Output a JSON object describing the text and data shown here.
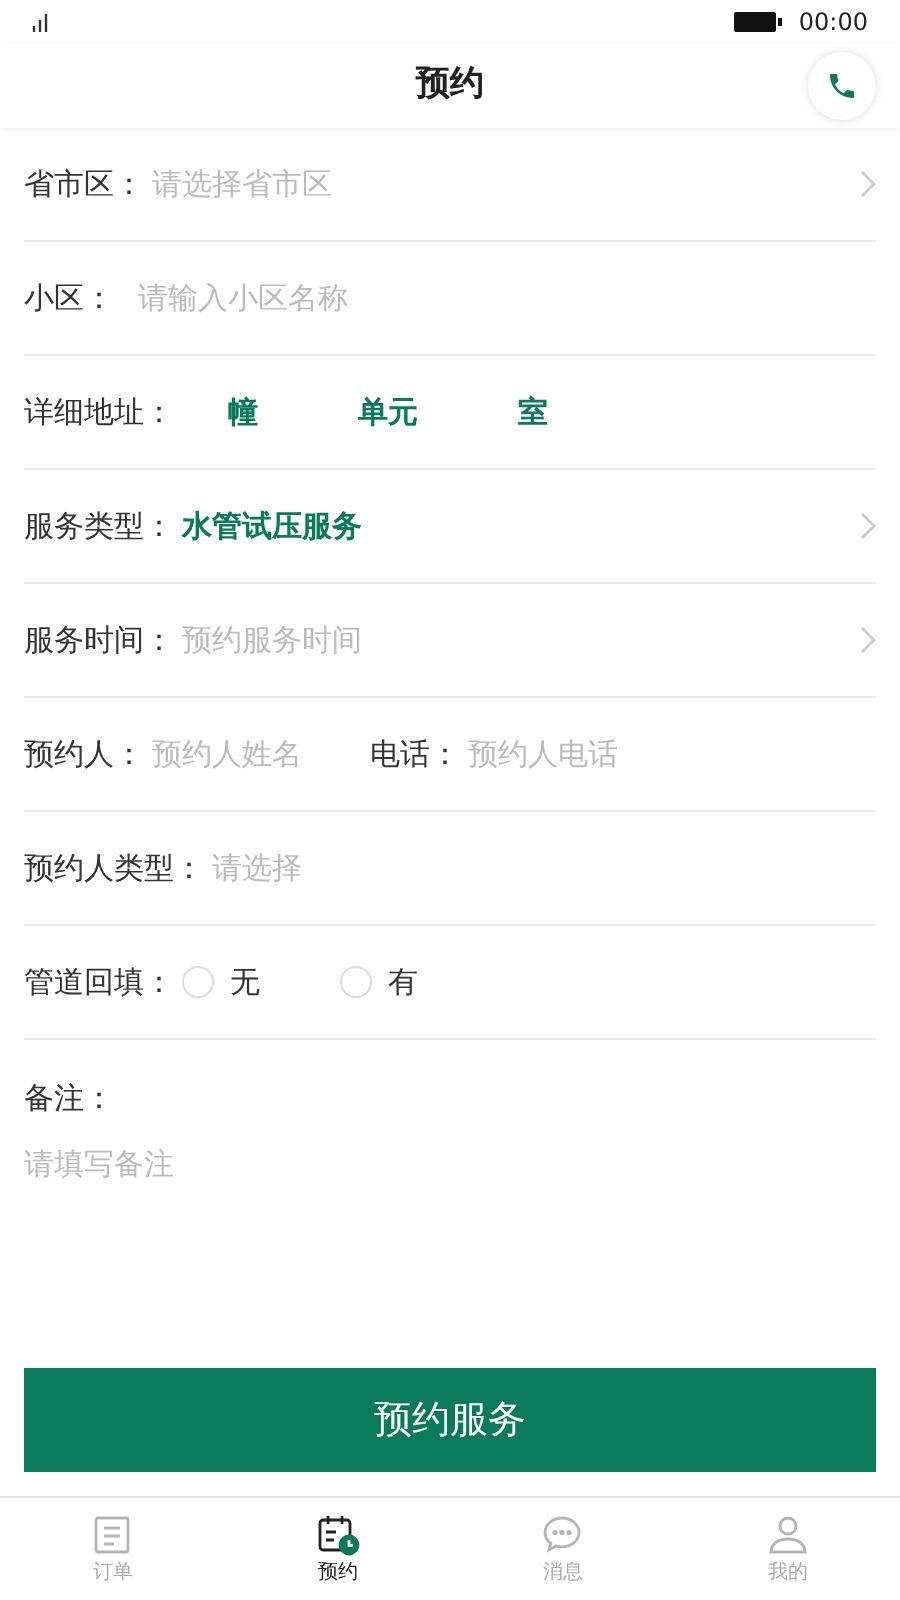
{
  "status_bar": {
    "time": "00:00"
  },
  "header": {
    "title": "预约"
  },
  "form": [
    {
      "kind": "select",
      "label": "省市区：",
      "placeholder": "请选择省市区",
      "chevron": true
    },
    {
      "kind": "input",
      "label": "小区：",
      "placeholder": "请输入小区名称"
    },
    {
      "kind": "address",
      "label": "详细地址：",
      "parts": [
        "幢",
        "单元",
        "室"
      ]
    },
    {
      "kind": "select",
      "label": "服务类型：",
      "value": "水管试压服务",
      "chevron": true
    },
    {
      "kind": "select",
      "label": "服务时间：",
      "placeholder": "预约服务时间",
      "chevron": true
    },
    {
      "kind": "pair",
      "label": "预约人：",
      "placeholder": "预约人姓名",
      "label_2": "电话：",
      "placeholder_2": "预约人电话"
    },
    {
      "kind": "select",
      "label": "预约人类型：",
      "placeholder": "请选择",
      "chevron": false
    },
    {
      "kind": "radio",
      "label": "管道回填：",
      "options": [
        {
          "label": "无",
          "selected": false
        },
        {
          "label": "有",
          "selected": false
        }
      ]
    },
    {
      "kind": "note",
      "label": "备注：",
      "placeholder": "请填写备注"
    }
  ],
  "submit": "预约服务",
  "tabs": [
    {
      "label": "订单",
      "selected": false
    },
    {
      "label": "预约",
      "selected": true
    },
    {
      "label": "消息",
      "selected": false
    },
    {
      "label": "我的",
      "selected": false
    }
  ]
}
